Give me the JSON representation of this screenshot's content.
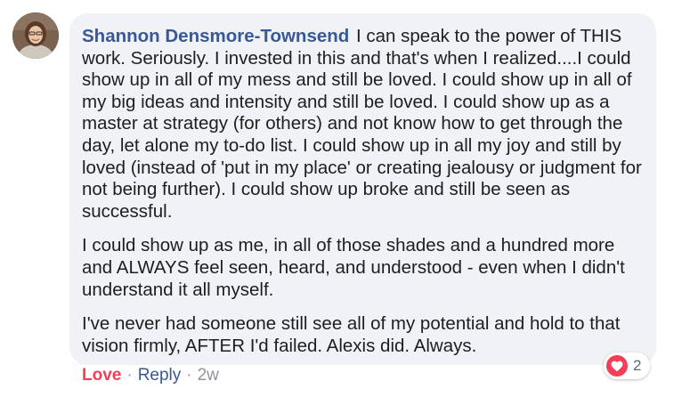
{
  "comment": {
    "author": "Shannon Densmore-Townsend",
    "paragraphs": [
      "I can speak to the power of THIS work. Seriously. I invested in this and that's when I realized....I could show up in all of my mess and still be loved. I could show up in all of my big ideas and intensity and still be loved. I could show up as a master at strategy (for others) and not know how to get through the day, let alone my to-do list. I could show up in all my joy and still by loved (instead of 'put in my place' or creating jealousy or judgment for not being further). I could show up broke and still be seen as successful.",
      "I could show up as me, in all of those shades and a hundred more and ALWAYS feel seen, heard, and understood - even when I didn't understand it all myself.",
      "I've never had someone still see all of my potential and hold to that vision firmly, AFTER I'd failed. Alexis did. Always."
    ],
    "reactions": {
      "icon": "heart-icon",
      "count": "2",
      "color": "#f33e58"
    },
    "actions": {
      "love_label": "Love",
      "reply_label": "Reply",
      "separator": "·",
      "timestamp": "2w"
    },
    "colors": {
      "author": "#385898",
      "bubble": "#f0f2f5",
      "love": "#f33e58",
      "meta": "#90949c"
    }
  }
}
